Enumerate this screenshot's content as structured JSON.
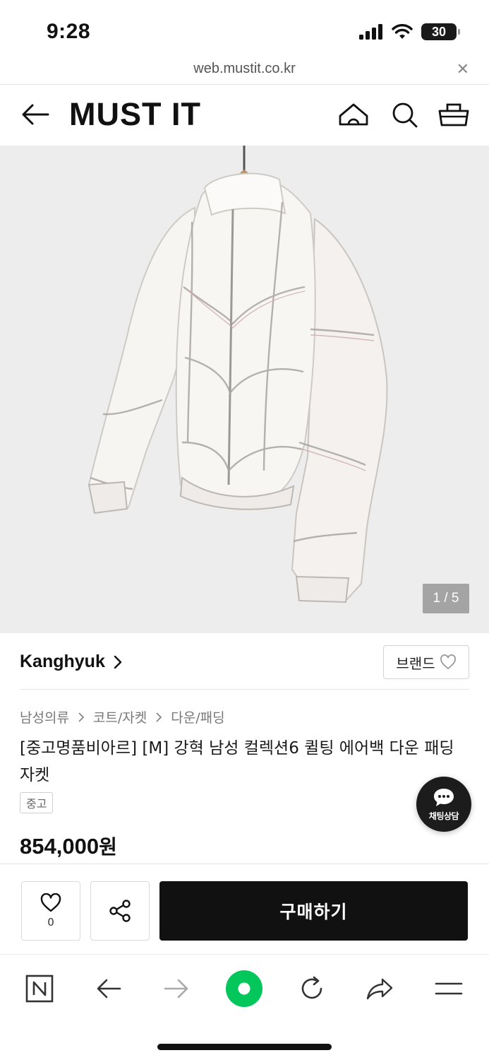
{
  "status_bar": {
    "time": "9:28",
    "battery_level": "30"
  },
  "browser": {
    "url": "web.mustit.co.kr",
    "close_glyph": "✕"
  },
  "header": {
    "logo": "MUST IT",
    "icons": [
      "back-arrow-icon",
      "home-icon",
      "search-icon",
      "cart-icon"
    ]
  },
  "gallery": {
    "counter": "1 / 5",
    "current": 1,
    "total": 5
  },
  "brand": {
    "name": "Kanghyuk",
    "like_label": "브랜드"
  },
  "product": {
    "breadcrumb": [
      "남성의류",
      "코트/자켓",
      "다운/패딩"
    ],
    "title": "[중고명품비아르] [M] 강혁 남성 컬렉션6 퀼팅 에어백 다운 패딩 자켓",
    "condition": "중고",
    "price": "854,000",
    "price_unit": "원"
  },
  "chat": {
    "label": "채팅상담"
  },
  "actions": {
    "wish_count": "0",
    "buy_label": "구매하기"
  },
  "toolbar": {
    "items": [
      "naver-n-icon",
      "back-arrow-icon",
      "forward-arrow-icon",
      "green-dot-icon",
      "refresh-icon",
      "share-arrow-icon",
      "menu-icon"
    ]
  },
  "colors": {
    "accent_green": "#03c75a",
    "buy_button": "#111111",
    "image_background": "#ededed"
  }
}
